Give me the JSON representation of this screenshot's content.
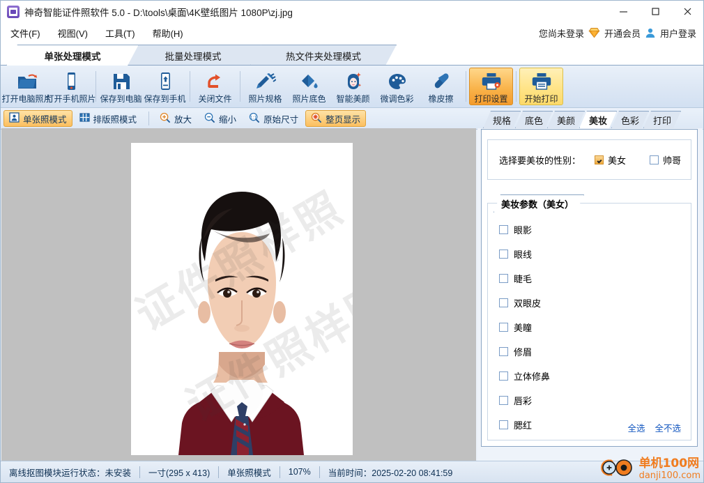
{
  "window": {
    "title": "神奇智能证件照软件 5.0 - D:\\tools\\桌面\\4K壁纸图片 1080P\\zj.jpg",
    "minimize": "—",
    "maximize": "□",
    "close": "✕"
  },
  "menu": {
    "items": [
      {
        "label": "文件(F)"
      },
      {
        "label": "视图(V)"
      },
      {
        "label": "工具(T)"
      },
      {
        "label": "帮助(H)"
      }
    ]
  },
  "account": {
    "status": "您尚未登录",
    "vip_label": "开通会员",
    "login_label": "用户登录"
  },
  "mode_tabs": [
    {
      "label": "单张处理模式",
      "active": true
    },
    {
      "label": "批量处理模式",
      "active": false
    },
    {
      "label": "热文件夹处理模式",
      "active": false
    }
  ],
  "toolbar": {
    "buttons": [
      {
        "label": "打开电脑照片",
        "icon": "open-folder-icon"
      },
      {
        "label": "打开手机照片",
        "icon": "phone-icon"
      },
      {
        "label": "保存到电脑",
        "icon": "floppy-save-icon"
      },
      {
        "label": "保存到手机",
        "icon": "phone-upload-icon"
      },
      {
        "label": "关闭文件",
        "icon": "close-file-icon"
      },
      {
        "label": "照片规格",
        "icon": "ruler-pencil-icon"
      },
      {
        "label": "照片底色",
        "icon": "paint-bucket-icon"
      },
      {
        "label": "智能美颜",
        "icon": "beauty-face-icon"
      },
      {
        "label": "微调色彩",
        "icon": "palette-icon"
      },
      {
        "label": "橡皮擦",
        "icon": "eraser-icon"
      },
      {
        "label": "打印设置",
        "icon": "printer-settings-icon"
      },
      {
        "label": "开始打印",
        "icon": "printer-icon"
      }
    ]
  },
  "viewbar": {
    "buttons": [
      {
        "label": "单张照模式",
        "icon": "single-photo-icon",
        "active": true
      },
      {
        "label": "排版照模式",
        "icon": "grid-layout-icon",
        "active": false
      },
      {
        "label": "放大",
        "icon": "zoom-in-icon",
        "active": false
      },
      {
        "label": "缩小",
        "icon": "zoom-out-icon",
        "active": false
      },
      {
        "label": "原始尺寸",
        "icon": "actual-size-icon",
        "active": false
      },
      {
        "label": "整页显示",
        "icon": "fit-page-icon",
        "active": true
      }
    ]
  },
  "canvas": {
    "watermark": "证件照样照"
  },
  "panel": {
    "tabs": [
      {
        "label": "规格",
        "active": false
      },
      {
        "label": "底色",
        "active": false
      },
      {
        "label": "美颜",
        "active": false
      },
      {
        "label": "美妆",
        "active": true
      },
      {
        "label": "色彩",
        "active": false
      },
      {
        "label": "打印",
        "active": false
      }
    ],
    "gender": {
      "label": "选择要美妆的性别：",
      "options": [
        {
          "label": "美女",
          "checked": true
        },
        {
          "label": "帅哥",
          "checked": false
        }
      ]
    },
    "group_title": "美妆参数（美女）",
    "options": [
      {
        "label": "眼影",
        "checked": false
      },
      {
        "label": "眼线",
        "checked": false
      },
      {
        "label": "睫毛",
        "checked": false
      },
      {
        "label": "双眼皮",
        "checked": false
      },
      {
        "label": "美瞳",
        "checked": false
      },
      {
        "label": "修眉",
        "checked": false
      },
      {
        "label": "立体修鼻",
        "checked": false
      },
      {
        "label": "唇彩",
        "checked": false
      },
      {
        "label": "腮红",
        "checked": false
      }
    ],
    "select_all": "全选",
    "select_none": "全不选"
  },
  "status": {
    "matting": "离线抠图模块运行状态：未安装",
    "size": "一寸(295 x 413)",
    "mode": "单张照模式",
    "zoom": "107%",
    "time": "当前时间：2025-02-20 08:41:59"
  },
  "brand": {
    "line1": "单机100网",
    "line2": "danji100.com"
  },
  "colors": {
    "accent_orange": "#f49b2c",
    "accent_yellow": "#ffe488",
    "panel_border": "#8ba5c4",
    "icon_blue": "#1f5c99",
    "link_blue": "#1558c0"
  }
}
